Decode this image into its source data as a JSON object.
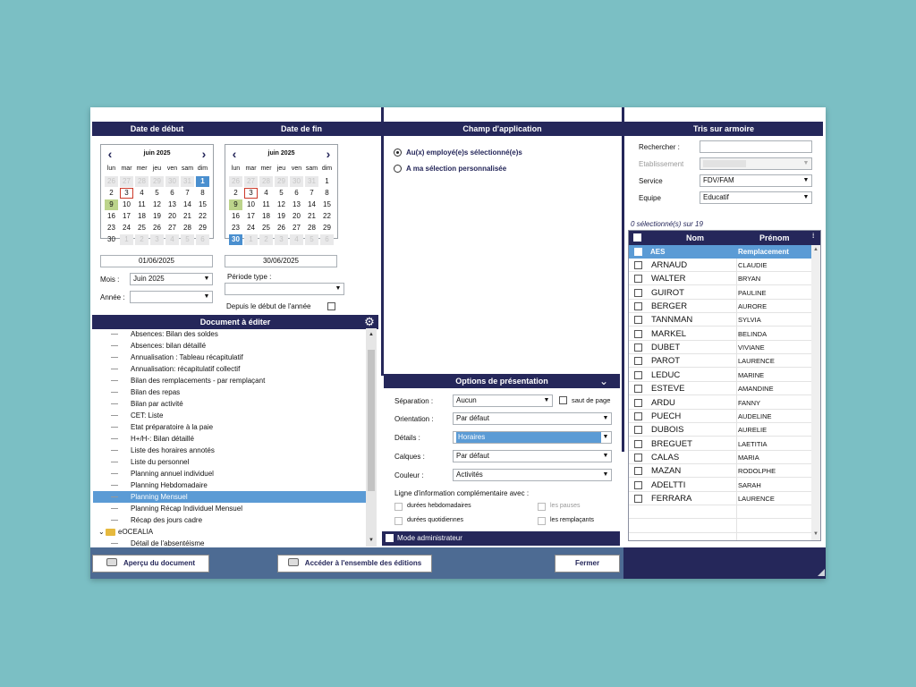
{
  "header": {
    "date_debut": "Date de début",
    "date_fin": "Date de fin",
    "champ": "Champ d'application",
    "tris": "Tris sur armoire",
    "doc": "Document à éditer",
    "options": "Options de présentation"
  },
  "cal_start": {
    "month": "juin 2025",
    "dow": [
      "lun",
      "mar",
      "mer",
      "jeu",
      "ven",
      "sam",
      "dim"
    ],
    "days": [
      "26",
      "27",
      "28",
      "29",
      "30",
      "31",
      "1",
      "2",
      "3",
      "4",
      "5",
      "6",
      "7",
      "8",
      "9",
      "10",
      "11",
      "12",
      "13",
      "14",
      "15",
      "16",
      "17",
      "18",
      "19",
      "20",
      "21",
      "22",
      "23",
      "24",
      "25",
      "26",
      "27",
      "28",
      "29",
      "30",
      "1",
      "2",
      "3",
      "4",
      "5",
      "6"
    ]
  },
  "cal_end": {
    "month": "juin 2025",
    "dow": [
      "lun",
      "mar",
      "mer",
      "jeu",
      "ven",
      "sam",
      "dim"
    ],
    "days": [
      "26",
      "27",
      "28",
      "29",
      "30",
      "31",
      "1",
      "2",
      "3",
      "4",
      "5",
      "6",
      "7",
      "8",
      "9",
      "10",
      "11",
      "12",
      "13",
      "14",
      "15",
      "16",
      "17",
      "18",
      "19",
      "20",
      "21",
      "22",
      "23",
      "24",
      "25",
      "26",
      "27",
      "28",
      "29",
      "30",
      "1",
      "2",
      "3",
      "4",
      "5",
      "6"
    ]
  },
  "dates": {
    "start": "01/06/2025",
    "end": "30/06/2025"
  },
  "period": {
    "mois_label": "Mois :",
    "mois_value": "Juin 2025",
    "annee_label": "Année :",
    "annee_value": "",
    "type_label": "Période type :",
    "type_value": "",
    "depuis_label": "Depuis le début de l'année"
  },
  "champ": {
    "opt1": "Au(x) employé(e)s sélectionné(e)s",
    "opt2": "A ma sélection personnalisée"
  },
  "documents": {
    "items": [
      "Absences: Bilan des soldes",
      "Absences: bilan détaillé",
      "Annualisation : Tableau récapitulatif",
      "Annualisation: récapitulatif collectif",
      "Bilan des remplacements - par remplaçant",
      "Bilan des repas",
      "Bilan par activité",
      "CET: Liste",
      "Etat préparatoire à la paie",
      "H+/H-: Bilan détaillé",
      "Liste des horaires annotés",
      "Liste du personnel",
      "Planning annuel individuel",
      "Planning Hebdomadaire",
      "Planning Mensuel",
      "Planning Récap Individuel Mensuel",
      "Récap des jours cadre"
    ],
    "group": "eOCEALIA",
    "partial": "Détail de l'absentéisme"
  },
  "options": {
    "separation_label": "Séparation :",
    "separation_value": "Aucun",
    "saut_label": "saut de page",
    "orientation_label": "Orientation :",
    "orientation_value": "Par défaut",
    "details_label": "Détails :",
    "details_value": "Horaires",
    "calques_label": "Calques :",
    "calques_value": "Par défaut",
    "couleur_label": "Couleur :",
    "couleur_value": "Activités",
    "ligne_label": "Ligne d'information complémentaire avec :",
    "hebdo": "durées hebdomadaires",
    "pauses": "les pauses",
    "quotid": "durées quotidiennes",
    "rempl": "les remplaçants",
    "admin": "Mode administrateur"
  },
  "tris": {
    "rechercher_label": "Rechercher :",
    "rechercher_value": "",
    "etab_label": "Etablissement",
    "etab_value": "",
    "service_label": "Service",
    "service_value": "FDV/FAM",
    "equipe_label": "Equipe",
    "equipe_value": "Educatif",
    "count": "0 sélectionné(s) sur 19"
  },
  "table": {
    "col_nom": "Nom",
    "col_prenom": "Prénom",
    "group_nom": "AES",
    "group_prenom": "Remplacement",
    "rows": [
      {
        "nom": "ARNAUD",
        "prenom": "CLAUDIE"
      },
      {
        "nom": "WALTER",
        "prenom": "BRYAN"
      },
      {
        "nom": "GUIROT",
        "prenom": "PAULINE"
      },
      {
        "nom": "BERGER",
        "prenom": "AURORE"
      },
      {
        "nom": "TANNMAN",
        "prenom": "SYLVIA"
      },
      {
        "nom": "MARKEL",
        "prenom": "BELINDA"
      },
      {
        "nom": "DUBET",
        "prenom": "VIVIANE"
      },
      {
        "nom": "PAROT",
        "prenom": "LAURENCE"
      },
      {
        "nom": "LEDUC",
        "prenom": "MARINE"
      },
      {
        "nom": "ESTEVE",
        "prenom": "AMANDINE"
      },
      {
        "nom": "ARDU",
        "prenom": "FANNY"
      },
      {
        "nom": "PUECH",
        "prenom": "AUDELINE"
      },
      {
        "nom": "DUBOIS",
        "prenom": "AURELIE"
      },
      {
        "nom": "BREGUET",
        "prenom": "LAETITIA"
      },
      {
        "nom": "CALAS",
        "prenom": "MARIA"
      },
      {
        "nom": "MAZAN",
        "prenom": "RODOLPHE"
      },
      {
        "nom": "ADELTTI",
        "prenom": "SARAH"
      },
      {
        "nom": "FERRARA",
        "prenom": "LAURENCE"
      }
    ]
  },
  "buttons": {
    "apercu": "Aperçu du document",
    "acceder": "Accéder à l'ensemble des éditions",
    "fermer": "Fermer"
  },
  "colors": {
    "header": "#25275a",
    "selected": "#5b9bd5",
    "weekend_green": "#bcd48b"
  }
}
